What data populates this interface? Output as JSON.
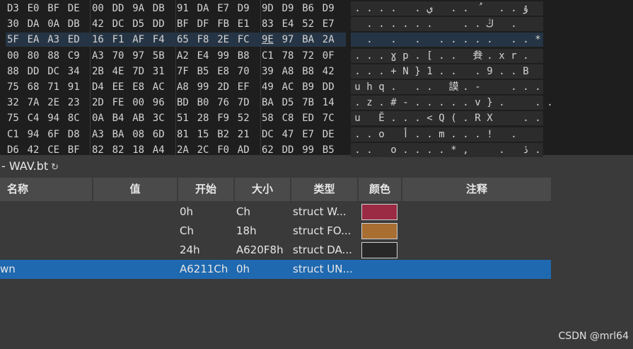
{
  "hex": {
    "rows": [
      {
        "bytes": [
          "D3",
          "E0",
          "BF",
          "DE",
          "00",
          "DD",
          "9A",
          "DB",
          "91",
          "DA",
          "E7",
          "D9",
          "9D",
          "D9",
          "B6",
          "D9"
        ],
        "text": [
          ".",
          ".",
          ".",
          ".",
          "  ",
          ".",
          "ي",
          "",
          ".",
          ".",
          "ُ",
          "",
          ".",
          ".",
          "ۇ",
          ""
        ]
      },
      {
        "bytes": [
          "30",
          "DA",
          "0A",
          "DB",
          "42",
          "DC",
          "D5",
          "DD",
          "BF",
          "DF",
          "FB",
          "E1",
          "83",
          "E4",
          "52",
          "E7"
        ],
        "text": [
          "",
          ".",
          ".",
          ".",
          ".",
          ".",
          ".",
          "",
          "",
          ".",
          ".",
          "ڭ",
          "",
          ".",
          "",
          ""
        ]
      },
      {
        "bytes": [
          "5F",
          "EA",
          "A3",
          "ED",
          "16",
          "F1",
          "AF",
          "F4",
          "65",
          "F8",
          "2E",
          "FC",
          "9E",
          "97",
          "BA",
          "2A"
        ],
        "text": [
          "",
          ".",
          "",
          ".",
          "",
          ".",
          "",
          ".",
          ".",
          ".",
          ".",
          ".",
          "",
          ".",
          ".",
          "*"
        ]
      },
      {
        "bytes": [
          "00",
          "80",
          "88",
          "C9",
          "A3",
          "70",
          "97",
          "5B",
          "A2",
          "E4",
          "99",
          "B8",
          "C1",
          "78",
          "72",
          "0F"
        ],
        "text": [
          ".",
          ".",
          ".",
          "ɣ",
          "p",
          ".",
          "[",
          ".",
          ".",
          "",
          "貵",
          ".",
          "x",
          "r",
          "."
        ]
      },
      {
        "bytes": [
          "88",
          "DD",
          "DC",
          "34",
          "2B",
          "4E",
          "7D",
          "31",
          "7F",
          "B5",
          "E8",
          "70",
          "39",
          "A8",
          "B8",
          "42"
        ],
        "text": [
          ".",
          ".",
          ".",
          "+",
          "N",
          "}",
          "1",
          ".",
          ".",
          "",
          ".",
          "9",
          ".",
          ".",
          "B",
          ""
        ]
      },
      {
        "bytes": [
          "75",
          "68",
          "71",
          "91",
          "D4",
          "EE",
          "E8",
          "AC",
          "A8",
          "99",
          "2D",
          "EF",
          "49",
          "AC",
          "B9",
          "DD"
        ],
        "text": [
          "u",
          "h",
          "q",
          ".",
          "",
          ".",
          ".",
          "",
          "謨",
          ".",
          "-",
          "",
          "",
          ".",
          ".",
          "."
        ]
      },
      {
        "bytes": [
          "32",
          "7A",
          "2E",
          "23",
          "2D",
          "FE",
          "00",
          "96",
          "BD",
          "B0",
          "76",
          "7D",
          "BA",
          "D5",
          "7B",
          "14"
        ],
        "text": [
          ".",
          "z",
          ".",
          "#",
          "-",
          ".",
          ".",
          ".",
          ".",
          ".",
          "v",
          "}",
          ".",
          "",
          "",
          ".",
          "."
        ]
      },
      {
        "bytes": [
          "75",
          "C4",
          "94",
          "8C",
          "0A",
          "B4",
          "AB",
          "3C",
          "51",
          "28",
          "F9",
          "52",
          "58",
          "C8",
          "ED",
          "7C"
        ],
        "text": [
          "u",
          "",
          "Ĕ",
          ".",
          ".",
          ".",
          "<",
          "Q",
          "(",
          ".",
          "R",
          "X",
          "",
          "",
          ".",
          "."
        ]
      },
      {
        "bytes": [
          "C1",
          "94",
          "6F",
          "D8",
          "A3",
          "BA",
          "08",
          "6D",
          "81",
          "15",
          "B2",
          "21",
          "DC",
          "47",
          "E7",
          "DE"
        ],
        "text": [
          ".",
          ".",
          "o",
          "",
          "أ",
          ".",
          ".",
          "m",
          ".",
          ".",
          ".",
          "!",
          "",
          ".",
          "",
          ""
        ]
      },
      {
        "bytes": [
          "D6",
          "42",
          "CE",
          "BF",
          "82",
          "82",
          "18",
          "A4",
          "2A",
          "2C",
          "F0",
          "AD",
          "62",
          "DD",
          "99",
          "B5"
        ],
        "text": [
          ".",
          ".",
          "",
          "o",
          ".",
          ".",
          ".",
          ".",
          "*",
          ",",
          "",
          "",
          ".",
          "",
          "ڏ",
          "."
        ]
      }
    ]
  },
  "template": {
    "title": "- WAV.bt",
    "refresh_icon": "↻",
    "columns": [
      "名称",
      "值",
      "开始",
      "大小",
      "类型",
      "颜色",
      "注释"
    ],
    "rows": [
      {
        "name": "",
        "value": "",
        "start": "0h",
        "size": "Ch",
        "type": "struct W...",
        "color": "#9b2a45"
      },
      {
        "name": "",
        "value": "",
        "start": "Ch",
        "size": "18h",
        "type": "struct FO...",
        "color": "#a86e32"
      },
      {
        "name": "",
        "value": "",
        "start": "24h",
        "size": "A620F8h",
        "type": "struct DA...",
        "color": "#282828"
      },
      {
        "name": "wn",
        "value": "",
        "start": "A6211Ch",
        "size": "0h",
        "type": "struct UN...",
        "color": ""
      }
    ]
  },
  "watermark": "CSDN @mrl64"
}
